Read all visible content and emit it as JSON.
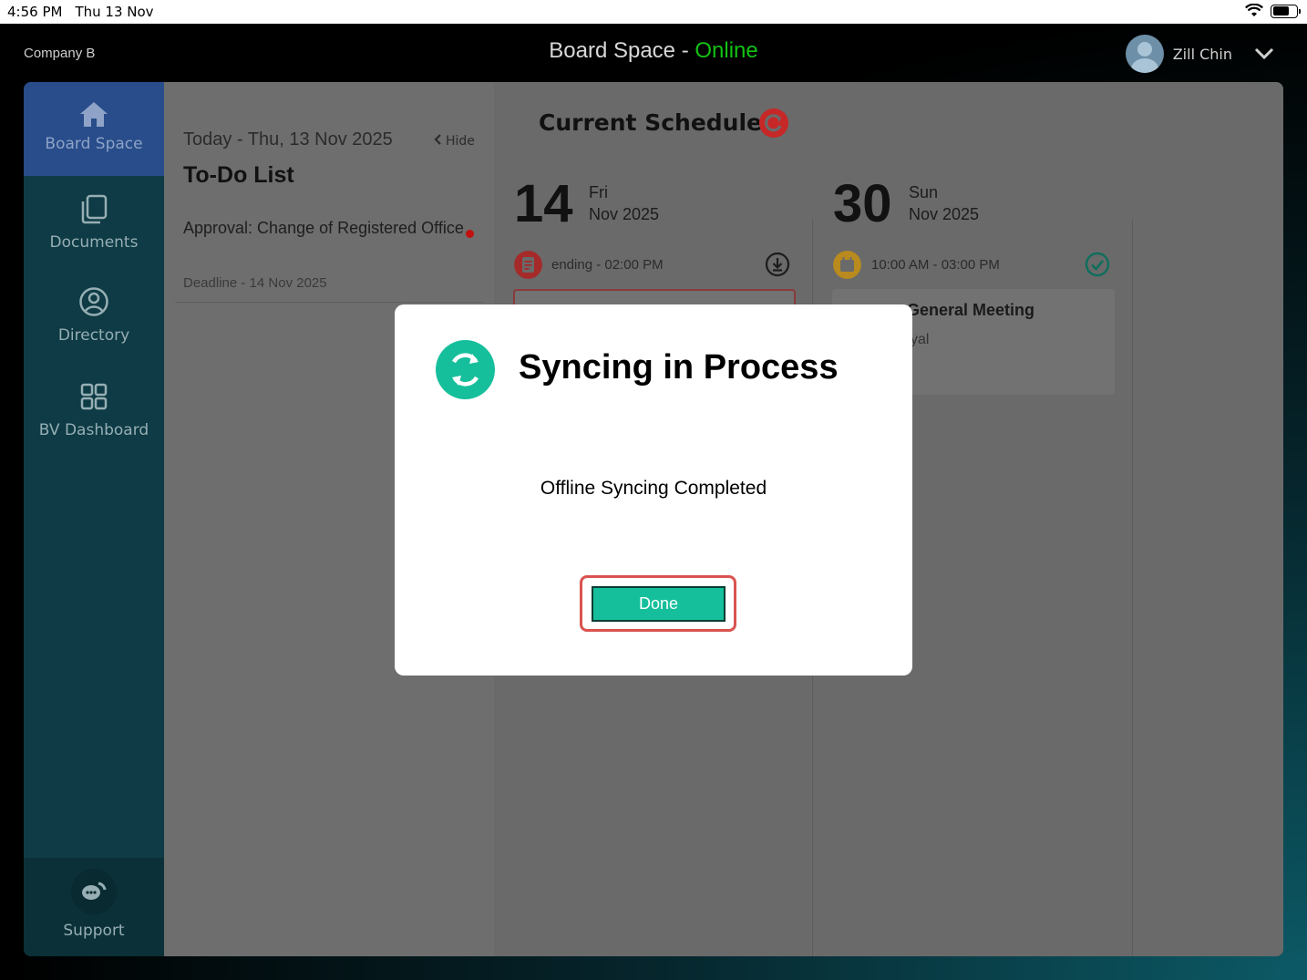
{
  "status_bar": {
    "time": "4:56 PM",
    "date": "Thu 13 Nov"
  },
  "header": {
    "company": "Company B",
    "app_name": "Board Space - ",
    "connection_status": "Online",
    "user_name": "Zill Chin",
    "status_color": "#14c214"
  },
  "sidebar": {
    "items": [
      {
        "label": "Board Space",
        "icon": "home-icon",
        "active": true
      },
      {
        "label": "Documents",
        "icon": "documents-icon"
      },
      {
        "label": "Directory",
        "icon": "user-circle-icon"
      },
      {
        "label": "BV Dashboard",
        "icon": "grid-icon"
      }
    ],
    "support_label": "Support"
  },
  "todo": {
    "today": "Today - Thu, 13 Nov 2025",
    "hide_label": "Hide",
    "title": "To-Do List",
    "items": [
      {
        "title": "Approval: Change of Registered Office",
        "deadline": "Deadline - 14 Nov 2025"
      }
    ]
  },
  "schedule": {
    "title": "Current Schedule",
    "days": [
      {
        "day": "14",
        "weekday": "Fri",
        "month_year": "Nov 2025",
        "event_time": "ending - 02:00 PM"
      },
      {
        "day": "30",
        "weekday": "Sun",
        "month_year": "Nov 2025",
        "event_time": "10:00 AM - 03:00 PM",
        "event_title": "General Meeting",
        "event_sub": "yal"
      }
    ]
  },
  "modal": {
    "title": "Syncing in Process",
    "message": "Offline Syncing Completed",
    "button_label": "Done",
    "accent": "#16bf9b"
  }
}
